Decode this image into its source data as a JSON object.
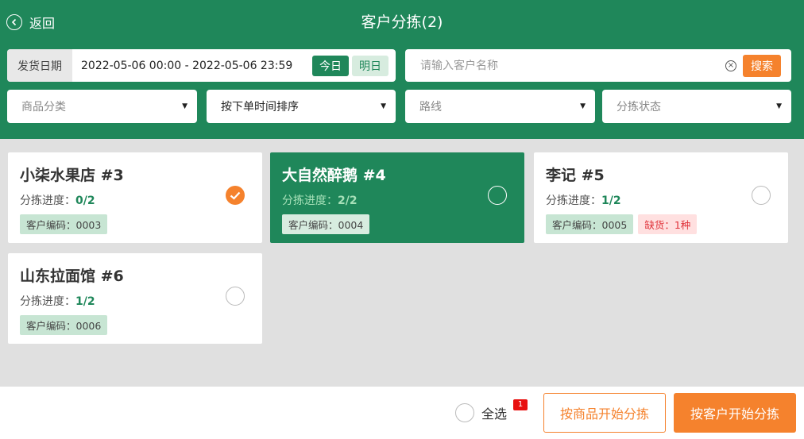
{
  "header": {
    "back_label": "返回",
    "title": "客户分拣(2)"
  },
  "filters": {
    "date_label": "发货日期",
    "date_range": "2022-05-06 00:00  -  2022-05-06 23:59",
    "today_label": "今日",
    "tomorrow_label": "明日",
    "search_placeholder": "请输入客户名称",
    "search_value": "",
    "search_button": "搜索",
    "category_placeholder": "商品分类",
    "sort_value": "按下单时间排序",
    "route_placeholder": "路线",
    "status_placeholder": "分拣状态"
  },
  "customers": [
    {
      "name": "小柒水果店 #3",
      "progress_label": "分拣进度：",
      "progress": "0/2",
      "code": "客户编码：0003",
      "shortage": "",
      "checked": true,
      "highlighted": false
    },
    {
      "name": "大自然醉鹅 #4",
      "progress_label": "分拣进度：",
      "progress": "2/2",
      "code": "客户编码：0004",
      "shortage": "",
      "checked": false,
      "highlighted": true
    },
    {
      "name": "李记 #5",
      "progress_label": "分拣进度：",
      "progress": "1/2",
      "code": "客户编码：0005",
      "shortage": "缺货：1种",
      "checked": false,
      "highlighted": false
    },
    {
      "name": "山东拉面馆 #6",
      "progress_label": "分拣进度：",
      "progress": "1/2",
      "code": "客户编码：0006",
      "shortage": "",
      "checked": false,
      "highlighted": false
    }
  ],
  "footer": {
    "select_all_label": "全选",
    "selected_count": "1",
    "by_product_button": "按商品开始分拣",
    "by_customer_button": "按客户开始分拣"
  },
  "colors": {
    "brand_green": "#1f875a",
    "accent_orange": "#f5822d",
    "badge_red": "#e8100f"
  }
}
